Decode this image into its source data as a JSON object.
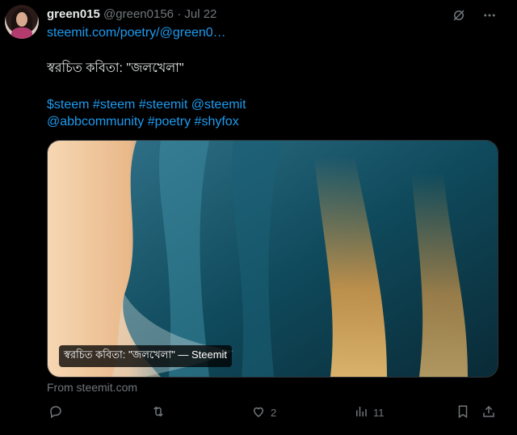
{
  "author": {
    "name": "green015",
    "handle": "@green0156",
    "separator": "·",
    "date": "Jul 22"
  },
  "tweet": {
    "link": "steemit.com/poetry/@green0…",
    "line1": "স্বরচিত কবিতা: \"জলখেলা\"",
    "line2": "$steem #steem #steemit @steemit",
    "line3": "@abbcommunity #poetry #shyfox"
  },
  "card": {
    "caption": "স্বরচিত কবিতা: \"জলখেলা\" — Steemit",
    "image_description_icon": "ocean-wave-image"
  },
  "source": "From steemit.com",
  "actions": {
    "reply": {
      "icon": "reply-icon",
      "count": ""
    },
    "retweet": {
      "icon": "retweet-icon",
      "count": ""
    },
    "like": {
      "icon": "heart-icon",
      "count": "2"
    },
    "views": {
      "icon": "views-icon",
      "count": "11"
    },
    "bookmark": {
      "icon": "bookmark-icon"
    },
    "share": {
      "icon": "share-icon"
    }
  },
  "colors": {
    "background": "#000000",
    "text": "#e7e9ea",
    "muted": "#71767b",
    "link": "#1d9bf0"
  }
}
